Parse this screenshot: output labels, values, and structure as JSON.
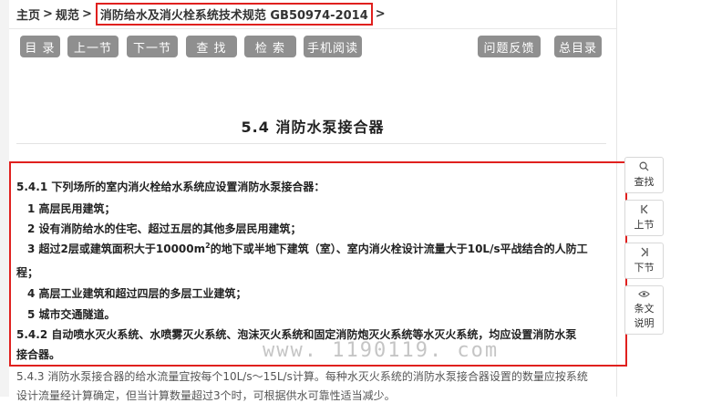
{
  "breadcrumb": {
    "home": "主页",
    "sep": ">",
    "category": "规范",
    "current": "消防给水及消火栓系统技术规范 GB50974-2014"
  },
  "toolbar": {
    "toc": "目 录",
    "prev": "上一节",
    "next": "下一节",
    "search": "查 找",
    "retrieve": "检 索",
    "mobile": "手机阅读",
    "feedback": "问题反馈",
    "master_toc": "总目录"
  },
  "section": {
    "title": "5.4  消防水泵接合器"
  },
  "content": {
    "p1": "5.4.1 下列场所的室内消火栓给水系统应设置消防水泵接合器：",
    "p1_items": [
      "1 高层民用建筑；",
      "2 设有消防给水的住宅、超过五层的其他多层民用建筑；",
      "3 超过2层或建筑面积大于10000m",
      "4 高层工业建筑和超过四层的多层工业建筑；",
      "5 城市交通隧道。"
    ],
    "p1_item3_sup": "2",
    "p1_item3_rest": "的地下或半地下建筑（室）、室内消火栓设计流量大于10L/s平战结合的人防工",
    "p1_item3_wrap": "程；",
    "p2_line1": "5.4.2 自动喷水灭火系统、水喷雾灭火系统、泡沫灭火系统和固定消防炮灭火系统等水灭火系统，均应设置消防水泵",
    "p2_line2": "接合器。",
    "p3_line1": "5.4.3 消防水泵接合器的给水流量宜按每个10L/s～15L/s计算。每种水灭火系统的消防水泵接合器设置的数量应按系统",
    "p3_line2": "设计流量经计算确定，但当计算数量超过3个时，可根据供水可靠性适当减少。"
  },
  "watermark": "www. 1190119. com",
  "side_tools": {
    "find": {
      "icon": "search-icon",
      "label": "查找"
    },
    "prev": {
      "icon": "skip-back-icon",
      "label": "上节"
    },
    "next": {
      "icon": "skip-forward-icon",
      "label": "下节"
    },
    "notes": {
      "icon": "eye-icon",
      "label_1": "条文",
      "label_2": "说明"
    }
  },
  "colors": {
    "accent_red": "#e0201e",
    "button_gray": "#8f8f8f"
  }
}
